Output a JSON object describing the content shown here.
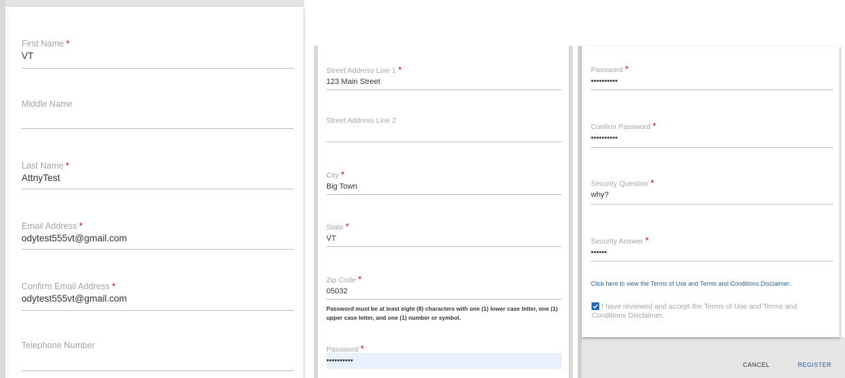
{
  "panel1": {
    "fields": [
      {
        "label": "First Name",
        "required": true,
        "value": "VT"
      },
      {
        "label": "Middle Name",
        "required": false,
        "value": ""
      },
      {
        "label": "Last Name",
        "required": true,
        "value": "AttnyTest"
      },
      {
        "label": "Email Address",
        "required": true,
        "value": "odytest555vt@gmail.com"
      },
      {
        "label": "Confirm Email Address",
        "required": true,
        "value": "odytest555vt@gmail.com"
      },
      {
        "label": "Telephone Number",
        "required": false,
        "value": ""
      }
    ]
  },
  "panel2": {
    "fields": [
      {
        "label": "Street Address Line 1",
        "required": true,
        "value": "123 Main Street"
      },
      {
        "label": "Street Address Line 2",
        "required": false,
        "value": ""
      },
      {
        "label": "City",
        "required": true,
        "value": "Big Town"
      },
      {
        "label": "State",
        "required": true,
        "value": "VT"
      },
      {
        "label": "Zip Code",
        "required": true,
        "value": "05032"
      }
    ],
    "password_hint": "Password must be at least eight (8) characters with one (1) lower case letter, one (1) upper case letter, and one (1) number or symbol.",
    "password": {
      "label": "Password",
      "required": true,
      "value": "••••••••••"
    }
  },
  "panel3": {
    "fields": [
      {
        "label": "Password",
        "required": true,
        "value": "••••••••••"
      },
      {
        "label": "Confirm Password",
        "required": true,
        "value": "••••••••••"
      },
      {
        "label": "Security Question",
        "required": true,
        "value": "why?"
      },
      {
        "label": "Security Answer",
        "required": true,
        "value": "••••••"
      }
    ],
    "terms_link": "Click here to view the Terms of Use and Terms and Conditions Disclaimer.",
    "accept_text": "I have reviewed and accept the Terms of Use and Terms and Conditions Disclaimer.",
    "accept_checked": true
  },
  "required_marker": "*",
  "buttons": {
    "cancel": "CANCEL",
    "register": "REGISTER"
  },
  "colors": {
    "accent": "#1f65b8",
    "required": "#d0021b",
    "link": "#2f5f95",
    "register": "#2a5d9c"
  }
}
